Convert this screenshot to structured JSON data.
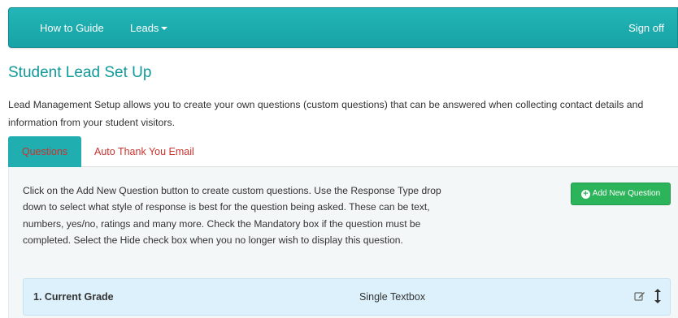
{
  "navbar": {
    "how_to_guide": "How to Guide",
    "leads": "Leads",
    "sign_off": "Sign off"
  },
  "page": {
    "title": "Student Lead Set Up",
    "intro": "Lead Management Setup allows you to create your own questions (custom questions) that can be answered when collecting contact details and information from your student visitors."
  },
  "tabs": [
    {
      "label": "Questions",
      "active": true
    },
    {
      "label": "Auto Thank You Email",
      "active": false
    }
  ],
  "questions_panel": {
    "help_text": "Click on the Add New Question button to create custom questions. Use the Response Type drop down to select what style of response is best for the question being asked. These can be text, numbers, yes/no, ratings and many more. Check the Mandatory box if the question must be completed. Select the Hide check box when you no longer wish to display this question.",
    "add_button_label": "Add New Question",
    "add_button_icon": "plus-circle-icon",
    "items": [
      {
        "title": "1. Current Grade",
        "response_type": "Single Textbox",
        "edit_icon": "edit-icon",
        "move_icon": "move-vertical-icon"
      }
    ]
  },
  "colors": {
    "navbar": "#1fadaf",
    "title": "#11999b",
    "active_tab": "#20aeb0",
    "tab_text": "#c8342e",
    "add_button": "#2cb45a",
    "question_row": "#dcf1fb"
  }
}
